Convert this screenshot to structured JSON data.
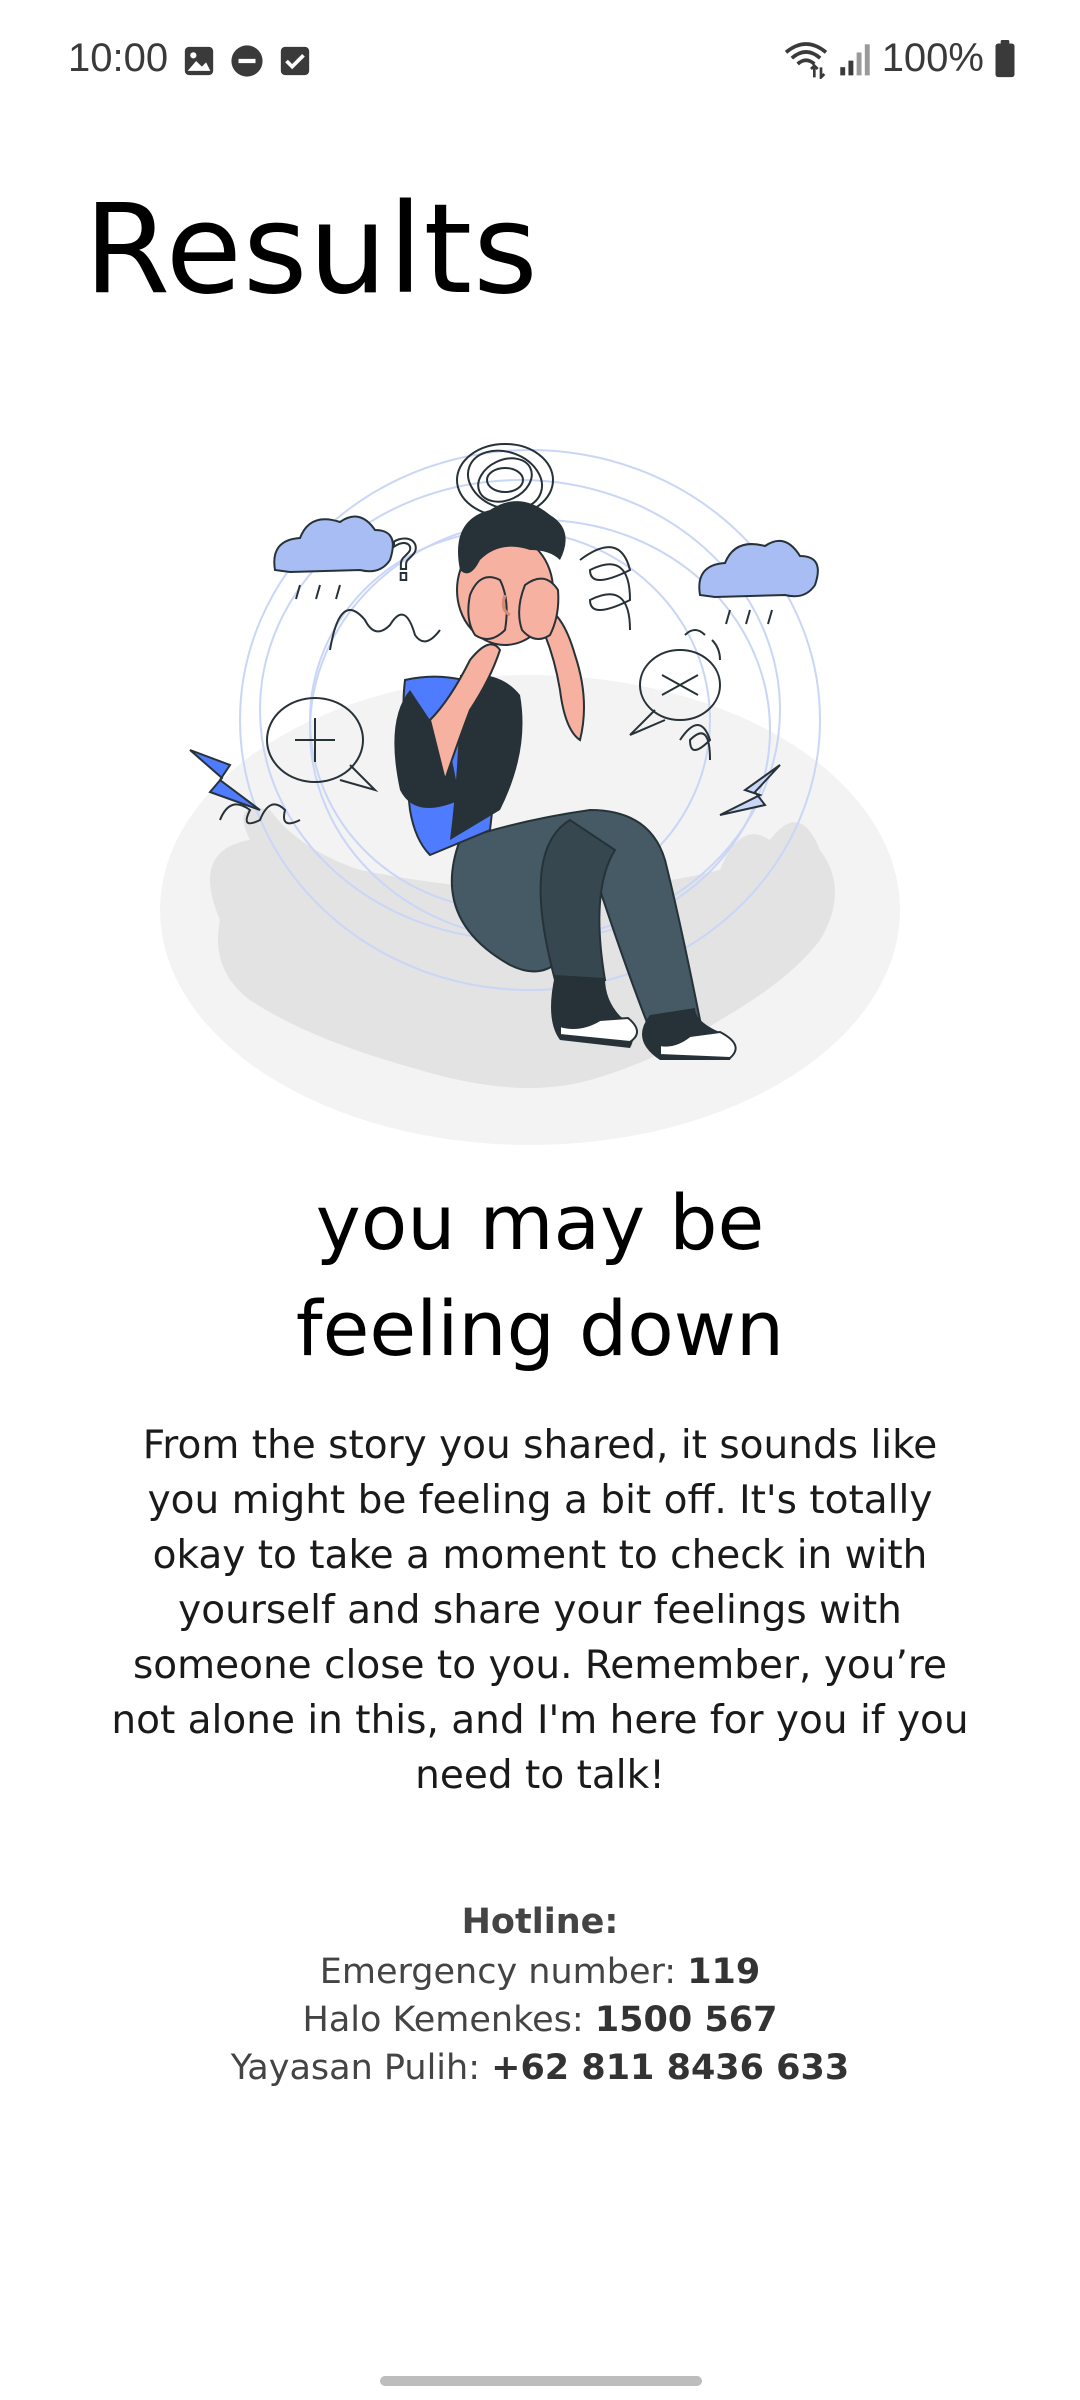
{
  "status_bar": {
    "time": "10:00",
    "left_icons": [
      "image-icon",
      "do-not-disturb-icon",
      "checkbox-icon"
    ],
    "right_icons": [
      "wifi-icon",
      "signal-icon",
      "battery-icon"
    ],
    "battery": "100%"
  },
  "page": {
    "title": "Results"
  },
  "illustration": {
    "icon": "sad-person-illustration",
    "colors": {
      "accent_blue": "#4f7cff",
      "hair": "#263238",
      "skin": "#f6b1a0",
      "pants": "#455a64",
      "shadow": "#e0e0e0",
      "light_blue": "#a9bdf5"
    }
  },
  "result": {
    "heading_line1": "you may be",
    "heading_line2": "feeling down",
    "description": "From the story you shared, it sounds like you might be feeling a bit off. It's totally okay to take a moment to check in with yourself and share your feelings with someone close to you. Remember, you’re not alone in this, and I'm here for you if you need to talk!"
  },
  "hotline": {
    "title": "Hotline:",
    "entries": [
      {
        "label": "Emergency number: ",
        "number": "119"
      },
      {
        "label": "Halo Kemenkes: ",
        "number": "1500 567"
      },
      {
        "label": "Yayasan Pulih: ",
        "number": "+62 811 8436 633"
      }
    ]
  }
}
